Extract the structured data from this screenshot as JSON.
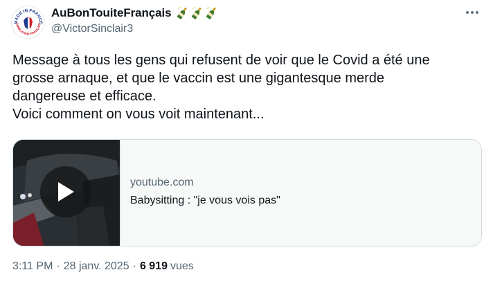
{
  "author": {
    "display_name": "AuBonTouiteFrançais",
    "handle": "@VictorSinclair3",
    "avatar_text_top": "MADE IN FRANCE",
    "avatar_text_bottom": "FABRICATION FRANÇAISE",
    "name_decorations": [
      "champagne-bottle-icon",
      "champagne-bottle-icon",
      "champagne-bottle-icon"
    ]
  },
  "more_icon": "ellipsis-icon",
  "tweet": {
    "lines": [
      "Message à tous les gens qui refusent de voir que le Covid a été une",
      "grosse arnaque, et que le vaccin est une gigantesque merde",
      "dangereuse et efficace.",
      "Voici comment on vous voit maintenant..."
    ]
  },
  "card": {
    "domain": "youtube.com",
    "title": "Babysitting : \"je vous vois pas\"",
    "thumbnail_icon": "play-icon"
  },
  "meta": {
    "time": "3:11 PM",
    "separator": "·",
    "date": "28 janv. 2025",
    "views_count": "6 919",
    "views_label": "vues"
  },
  "colors": {
    "text_primary": "#0f1419",
    "text_secondary": "#536471",
    "border": "#cfd9de",
    "card_bg": "#f7f9f9",
    "flag_blue": "#1a3a8f",
    "flag_red": "#d4202a"
  }
}
